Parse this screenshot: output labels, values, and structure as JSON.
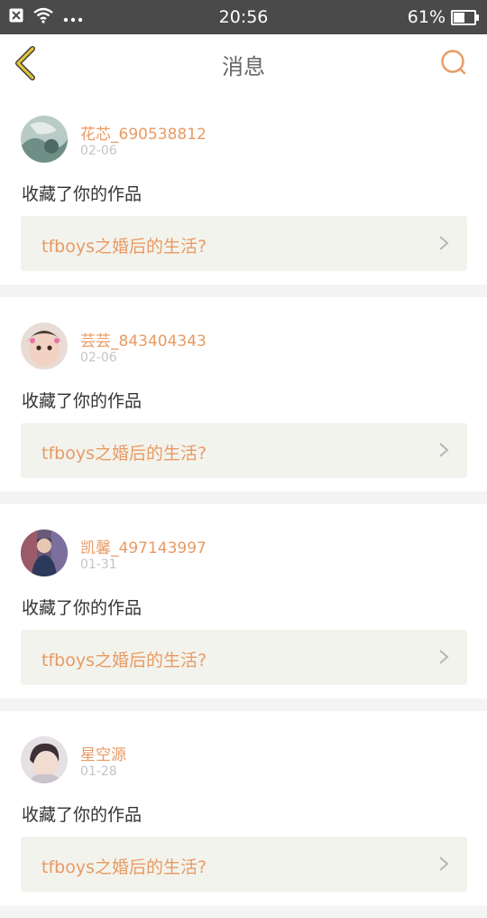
{
  "status_bar": {
    "time": "20:56",
    "battery": "61%",
    "battery_level": 0.61,
    "icons": [
      "close-notification-icon",
      "wifi-icon",
      "more-dots-icon",
      "battery-icon"
    ]
  },
  "header": {
    "title": "消息",
    "back_icon": "chevron-left-icon",
    "search_icon": "search-icon"
  },
  "colors": {
    "accent": "#e99a63",
    "back_icon": "#e0c33a",
    "status_bar": "#4a4a4a"
  },
  "notifications": [
    {
      "user": "花芯_690538812",
      "date": "02-06",
      "action": "收藏了你的作品",
      "work_title": "tfboys之婚后的生活?"
    },
    {
      "user": "芸芸_843404343",
      "date": "02-06",
      "action": "收藏了你的作品",
      "work_title": "tfboys之婚后的生活?"
    },
    {
      "user": "凯馨_497143997",
      "date": "01-31",
      "action": "收藏了你的作品",
      "work_title": "tfboys之婚后的生活?"
    },
    {
      "user": "星空源",
      "date": "01-28",
      "action": "收藏了你的作品",
      "work_title": "tfboys之婚后的生活?"
    }
  ]
}
